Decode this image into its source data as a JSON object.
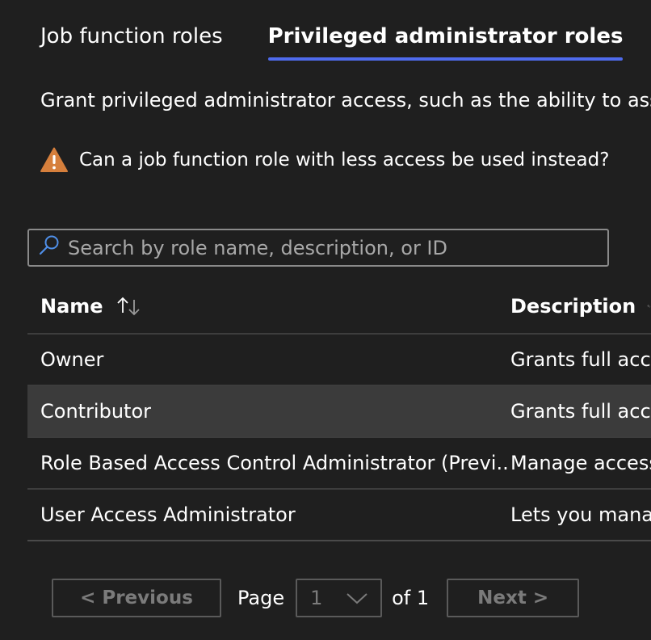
{
  "tabs": [
    {
      "label": "Job function roles",
      "active": false
    },
    {
      "label": "Privileged administrator roles",
      "active": true
    }
  ],
  "description": "Grant privileged administrator access, such as the ability to assign",
  "warning": {
    "icon": "warning-icon",
    "text": "Can a job function role with less access be used instead?",
    "color": "#d67f3c"
  },
  "search": {
    "placeholder": "Search by role name, description, or ID",
    "value": ""
  },
  "table": {
    "columns": [
      {
        "label": "Name",
        "sort_icon": "sort-icon"
      },
      {
        "label": "Description",
        "sort_icon": "sort-icon"
      }
    ],
    "rows": [
      {
        "name": "Owner",
        "description": "Grants full acce"
      },
      {
        "name": "Contributor",
        "description": "Grants full acce"
      },
      {
        "name": "Role Based Access Control Administrator (Previ...",
        "description": "Manage access"
      },
      {
        "name": "User Access Administrator",
        "description": "Lets you manag"
      }
    ]
  },
  "pager": {
    "previous_label": "< Previous",
    "page_label": "Page",
    "current_page": "1",
    "of_label": "of 1",
    "next_label": "Next >"
  },
  "colors": {
    "background": "#1f1f1f",
    "accent": "#4f6bed",
    "row_hover": "#3b3b3b",
    "search_icon": "#4f8fe8"
  }
}
